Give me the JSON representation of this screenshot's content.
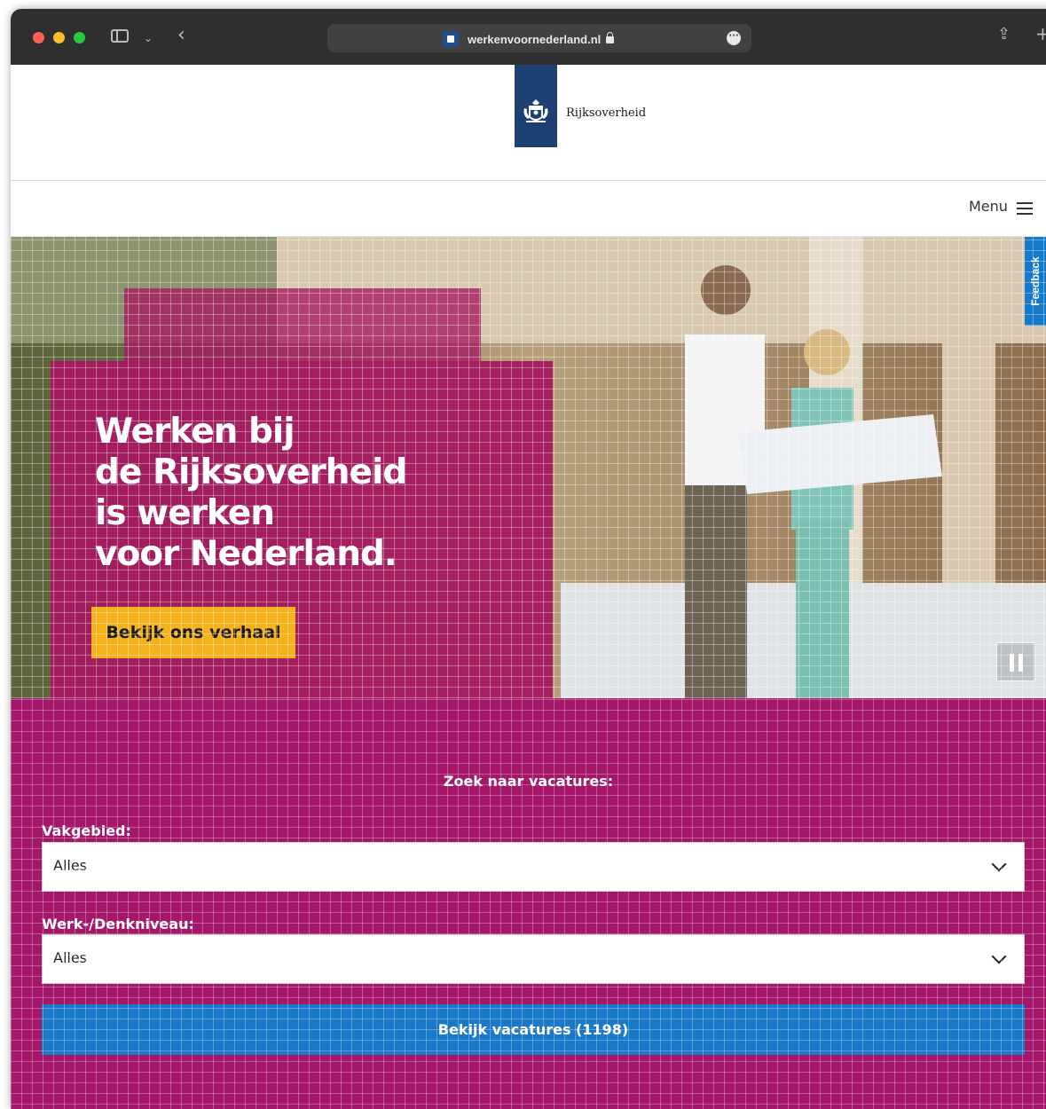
{
  "browser": {
    "url": "werkenvoornederland.nl",
    "icons": [
      "close-dot",
      "minimize-dot",
      "maximize-dot",
      "sidebar-icon",
      "chevron-down-icon",
      "back-icon",
      "lock-icon",
      "more-icon",
      "share-icon",
      "new-tab-icon"
    ]
  },
  "header": {
    "logo_text": "Rijksoverheid"
  },
  "nav": {
    "menu_label": "Menu"
  },
  "hero": {
    "title_lines": [
      "Werken bij",
      "de Rijksoverheid",
      "is werken",
      "voor Nederland."
    ],
    "cta_label": "Bekijk ons verhaal",
    "feedback_label": "Feedback"
  },
  "search": {
    "title": "Zoek naar vacatures:",
    "field1_label": "Vakgebied:",
    "field1_value": "Alles",
    "field2_label": "Werk-/Denkniveau:",
    "field2_value": "Alles",
    "submit_label": "Bekijk vacatures (1198)"
  },
  "colors": {
    "magenta": "#a5176a",
    "yellow": "#f6b21b",
    "blue": "#1a78c8",
    "logo_blue": "#1d3f72"
  }
}
